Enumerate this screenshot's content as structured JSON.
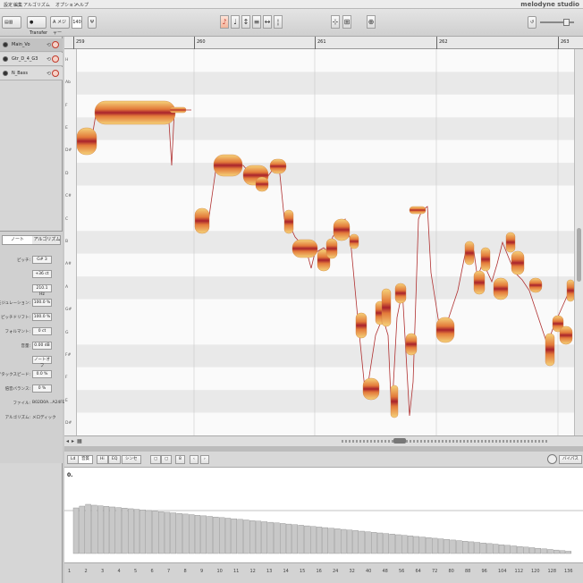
{
  "menu": [
    "設定",
    "編集",
    "アルゴリズム",
    "オプション",
    "ヘルプ"
  ],
  "brand": "melodyne studio",
  "toolbar": {
    "transfer_label": "Transfer",
    "mode_label": "A メジャー",
    "tempo_value": "140",
    "tools": [
      {
        "icon": "main-tool-icon",
        "glyph": "♪"
      },
      {
        "icon": "pitch-tool-icon",
        "glyph": "♩"
      },
      {
        "icon": "formant-tool-icon",
        "glyph": "↕"
      },
      {
        "icon": "amplitude-tool-icon",
        "glyph": "≡"
      },
      {
        "icon": "time-tool-icon",
        "glyph": "↔"
      },
      {
        "icon": "separation-tool-icon",
        "glyph": "¦"
      }
    ]
  },
  "tracks": [
    {
      "name": "Main_Vo",
      "active": true
    },
    {
      "name": "Gtr_D_4_G3",
      "active": false
    },
    {
      "name": "N_Bass",
      "active": false
    }
  ],
  "ruler": {
    "bars": [
      "259",
      "260",
      "261",
      "262",
      "263"
    ]
  },
  "keys": [
    "H",
    "Ab",
    "F",
    "E",
    "D#",
    "D",
    "C#",
    "C",
    "B",
    "A#",
    "A",
    "G#",
    "G",
    "F#",
    "F",
    "E",
    "D#"
  ],
  "inspector": {
    "tabs": [
      "ノート",
      "アルゴリズム"
    ],
    "rows": [
      {
        "label": "ピッチ:",
        "value": "G# 3",
        "type": "field"
      },
      {
        "label": "",
        "value": "+36 ct",
        "type": "field"
      },
      {
        "label": "",
        "value": "210.1 Hz",
        "type": "field"
      },
      {
        "label": "ピッチモジュレーション:",
        "value": "100.0 %",
        "type": "field"
      },
      {
        "label": "ピッチドリフト:",
        "value": "100.0 %",
        "type": "field"
      },
      {
        "label": "フォルマント:",
        "value": "0 ct",
        "type": "field"
      },
      {
        "label": "音量:",
        "value": "0.00 dB",
        "type": "field"
      },
      {
        "label": "",
        "value": "ノートオフ",
        "type": "field"
      },
      {
        "label": "アタックスピード:",
        "value": "0.0 %",
        "type": "field"
      },
      {
        "label": "倍音バランス:",
        "value": "0 %",
        "type": "field"
      },
      {
        "label": "ファイル:",
        "value": "B02D0A...A24FE",
        "type": "text"
      },
      {
        "label": "アルゴリズム:",
        "value": "メロディック",
        "type": "text"
      }
    ]
  },
  "lower": {
    "left_btn": "Ld",
    "tabs": [
      "音質",
      "Hi",
      "EQ",
      "シンセ"
    ],
    "num_label": "8",
    "right_label": "バイパス",
    "graph_label": "0.",
    "axis_numbers": [
      "1",
      "2",
      "3",
      "4",
      "5",
      "6",
      "7",
      "8",
      "9",
      "10",
      "11",
      "12",
      "13",
      "14",
      "15",
      "16",
      "24",
      "32",
      "40",
      "48",
      "56",
      "64",
      "72",
      "80",
      "88",
      "96",
      "104",
      "112",
      "120",
      "128",
      "136"
    ]
  },
  "colors": {
    "blob_core": "#c0392b",
    "blob_edge": "#f0b030",
    "accent": "#c0392b",
    "grid_dark": "#e9e9e9"
  }
}
